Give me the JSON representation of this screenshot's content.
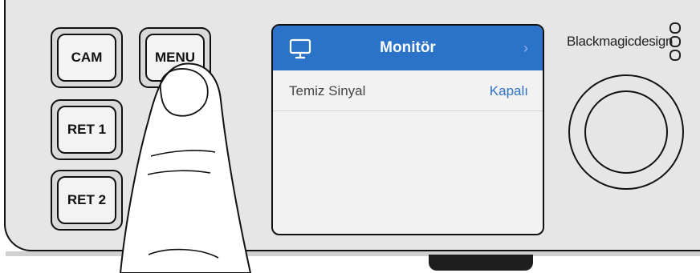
{
  "buttons": {
    "cam": "CAM",
    "menu": "MENU",
    "ret1": "RET 1",
    "ret2": "RET 2"
  },
  "screen": {
    "title": "Monitör",
    "icon": "monitor-icon",
    "chevron": "›",
    "rows": [
      {
        "label": "Temiz Sinyal",
        "value": "Kapalı"
      }
    ],
    "header_color": "#2a73c9",
    "value_color": "#2f72c4"
  },
  "brand": {
    "logo": "Blackmagicdesign"
  }
}
